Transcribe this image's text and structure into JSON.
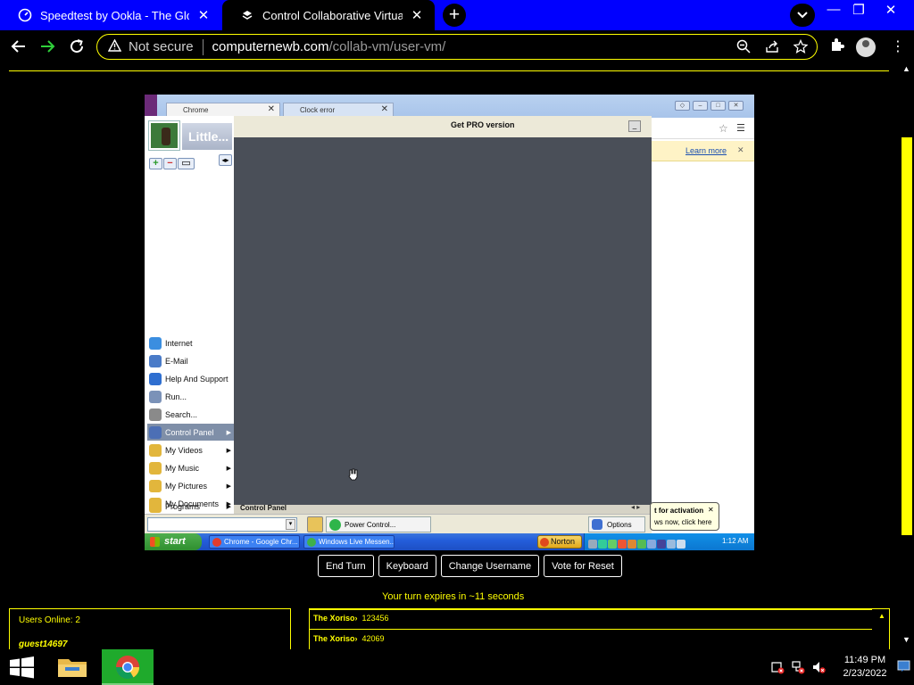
{
  "browser": {
    "tabs": [
      {
        "title": "Speedtest by Ookla - The Global"
      },
      {
        "title": "Control Collaborative Virtual Ma"
      }
    ],
    "address": {
      "security": "Not secure",
      "host": "computernewb.com",
      "path": "/collab-vm/user-vm/"
    }
  },
  "vm": {
    "chrome_tabs": [
      {
        "title": "Chrome"
      },
      {
        "title": "Clock error"
      }
    ],
    "learn_more": "Learn more",
    "activation": {
      "title": "t for activation",
      "text": "ws now, click here"
    },
    "start_menu": {
      "user": "Little...",
      "items": [
        {
          "label": "Internet",
          "color": "#3b8ee0"
        },
        {
          "label": "E-Mail",
          "color": "#4a7bc8"
        },
        {
          "label": "Help And Support",
          "color": "#2f6fd0"
        },
        {
          "label": "Run...",
          "color": "#7b92b8"
        },
        {
          "label": "Search...",
          "color": "#8a8a8a"
        },
        {
          "label": "Control Panel",
          "color": "#4c6fb5"
        },
        {
          "label": "My Videos",
          "color": "#e2b63c"
        },
        {
          "label": "My Music",
          "color": "#e2b63c"
        },
        {
          "label": "My Pictures",
          "color": "#e2b63c"
        },
        {
          "label": "My Documents",
          "color": "#e2b63c"
        },
        {
          "label": "Programs",
          "color": "#e2b63c"
        }
      ],
      "pro_label": "Get PRO version",
      "status_label": "Control Panel",
      "power_label": "Power Control...",
      "options_label": "Options"
    },
    "taskbar": {
      "start_label": "start",
      "tasks": [
        {
          "label": "Chrome - Google Chr...",
          "color": "#e23c2c"
        },
        {
          "label": "Windows Live Messen...",
          "color": "#3fb04b"
        }
      ],
      "norton_label": "Norton",
      "clock": "1:12 AM"
    }
  },
  "controls": {
    "buttons": [
      "End Turn",
      "Keyboard",
      "Change Username",
      "Vote for Reset"
    ],
    "turn_message": "Your turn expires in ~11 seconds"
  },
  "users": {
    "online": "Users Online: 2",
    "guest": "guest14697"
  },
  "chat": {
    "messages": [
      {
        "user": "The Xoriso",
        "text": "123456"
      },
      {
        "user": "The Xoriso",
        "text": "42069"
      }
    ]
  },
  "taskbar": {
    "time": "11:49 PM",
    "date": "2/23/2022"
  },
  "colors": {
    "accent": "#ffff00",
    "tabstrip": "#0000ff"
  }
}
